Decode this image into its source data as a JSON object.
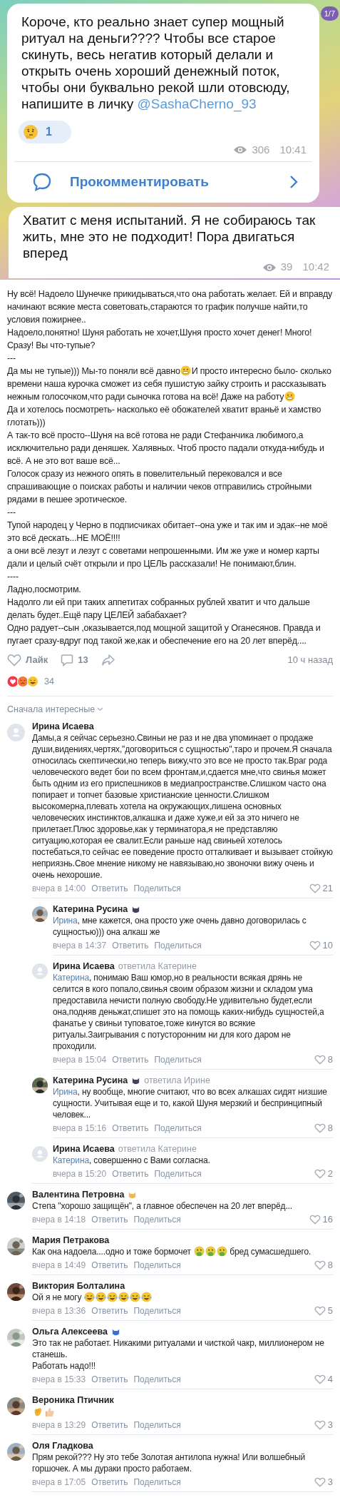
{
  "telegram": {
    "counter": "1/7",
    "messages": [
      {
        "body": [
          {
            "kind": "text",
            "text": "Короче, кто реально знает супер мощный ритуал на деньги???? Чтобы все старое скинуть, весь негатив который делали и открыть очень хороший денежный поток, чтобы они буквально рекой шли отовсюду, напишите в личку "
          },
          {
            "kind": "mention",
            "text": "@SashaCherno_93"
          }
        ],
        "reactions": [
          {
            "count": "1"
          }
        ],
        "views": "306",
        "time": "10:41",
        "comment_label": "Прокомментировать"
      },
      {
        "body": [
          {
            "kind": "text",
            "text": "Хватит с меня испытаний. Я не собираюсь так жить, мне это не подходит! Пора двигаться вперед"
          }
        ],
        "views": "39",
        "time": "10:42"
      }
    ]
  },
  "post": {
    "paragraphs": [
      [
        {
          "kind": "text",
          "text": "Ну всё! Надоело Шунечке прикидываться,что она работать желает. Ей и вправду начинают всякие места советовать,стараются то график получше найти,то условия пожирнее.."
        }
      ],
      [
        {
          "kind": "text",
          "text": "Надоело,понятно! Шуня работать не хочет,Шуня просто хочет денег! Много! Сразу! Вы что-тупые?"
        }
      ],
      [
        {
          "kind": "text",
          "text": "---"
        }
      ],
      [
        {
          "kind": "text",
          "text": "Да мы не тупые))) Мы-то поняли всё давно"
        },
        {
          "kind": "grin"
        },
        {
          "kind": "text",
          "text": "И просто интересно было- сколько времени наша курочка сможет из себя пушистую зайку строить и рассказывать нежным голосочком,что ради сыночка готова на всё! Даже на работу"
        },
        {
          "kind": "grin"
        }
      ],
      [
        {
          "kind": "text",
          "text": "Да и хотелось посмотреть- насколько её обожателей хватит враньё и хамство глотать)))"
        }
      ],
      [
        {
          "kind": "text",
          "text": "А так-то всё просто--Шуня на всё готова не ради Стефанчика любимого,а исключительно ради деняшек. Халявных. Чтоб просто падали откуда-нибудь и всё. А не это вот ваше всё..."
        }
      ],
      [
        {
          "kind": "text",
          "text": "Голосок сразу из нежного опять в повелительный перековался и все спрашивающие о поисках работы и наличии чеков отправились стройными рядами в пешее эротическое."
        }
      ],
      [
        {
          "kind": "text",
          "text": "---"
        }
      ],
      [
        {
          "kind": "text",
          "text": "Тупой народец у Черно в подписчиках обитает--она уже и так им и эдак--не моё это всё дескать...НЕ МОЁ!!!!"
        }
      ],
      [
        {
          "kind": "text",
          "text": "а они всё лезут и лезут с советами непрошенными. Им же уже и номер карты дали и целый счёт открыли и про ЦЕЛЬ рассказали! Не понимают,блин."
        }
      ],
      [
        {
          "kind": "text",
          "text": "----"
        }
      ],
      [
        {
          "kind": "text",
          "text": "Ладно,посмотрим."
        }
      ],
      [
        {
          "kind": "text",
          "text": "Надолго ли ей при таких аппетитах собранных рублей хватит и что дальше делать будет..Ещё пару ЦЕЛЕЙ забабахает?"
        }
      ],
      [
        {
          "kind": "text",
          "text": "Одно радует--сын ,оказывается,под мощной защитой у Оганесянов. Правда и пугает сразу-вдруг под такой же,как и обеспечение его на 20 лет вперёд...."
        }
      ]
    ],
    "like_label": "Лайк",
    "comments_count": "13",
    "time": "10 ч назад",
    "reactions_count": "34"
  },
  "comments_sort": "Сначала интересные",
  "comments": [
    {
      "author": "Ирина Исаева",
      "photo_avatar": false,
      "body": [
        [
          {
            "kind": "text",
            "text": "Дамы,а я сейчас серьезно.Свиньи не раз и не два упоминает о продаже души,видениях,чертях,\"договориться с сущностью\",таро и прочем.Я сначала относилась скептически,но теперь вижу,что это все не просто так.Враг рода человеческого ведет бои по всем фронтам,и,сдается мне,что свинья может быть одним из его приспешников в медиапространстве.Слишком часто она попирает и топчет базовые христианские ценности.Слишком высокомерна,плевать хотела на окружающих,лишена основных человеческих инстинктов,алкашка и даже хуже,и ей за это ничего не прилетает.Плюс здоровье,как у терминатора,я не представляю ситуацию,которая ее свалит.Если раньше над свиньей хотелось постебаться,то сейчас ее поведение просто отталкивает и вызывает стойкую неприязнь.Свое мнение никому не навязываю,но звоночки вижу очень и очень нехорошие."
          }
        ]
      ],
      "time": "вчера в 14:00",
      "reply_label": "Ответить",
      "share_label": "Поделиться",
      "likes": "21",
      "children": [
        {
          "author": "Катерина Русина",
          "badge": {
            "color": "#4a3f5c"
          },
          "photo_avatar": true,
          "body": [
            [
              {
                "kind": "mention",
                "text": "Ирина"
              },
              {
                "kind": "text",
                "text": ", мне кажется, она просто уже очень давно договорилась с сущностью))) она алкаш же"
              }
            ]
          ],
          "time": "вчера в 14:37",
          "reply_label": "Ответить",
          "share_label": "Поделиться",
          "likes": "10"
        },
        {
          "author": "Ирина Исаева",
          "replied_to": "ответила Катерине",
          "photo_avatar": false,
          "body": [
            [
              {
                "kind": "mention",
                "text": "Катерина"
              },
              {
                "kind": "text",
                "text": ", понимаю Ваш юмор,но в реальности всякая дрянь не селится в кого попало,свинья своим образом жизни и складом ума предоставила нечисти полную свободу.Не удивительно будет,если она,подняв деньжат,спишет это на помощь каких-нибудь сущностей,а фанатье у свиньи туповатое,тоже кинутся во всякие ритуалы.Заигрывания с потусторонним ни для кого даром не проходили."
              }
            ]
          ],
          "time": "вчера в 15:04",
          "reply_label": "Ответить",
          "share_label": "Поделиться",
          "likes": "8"
        },
        {
          "author": "Катерина Русина",
          "badge": {
            "color": "#4a3f5c"
          },
          "replied_to": "ответила Ирине",
          "photo_avatar": true,
          "body": [
            [
              {
                "kind": "mention",
                "text": "Ирина"
              },
              {
                "kind": "text",
                "text": ", ну вообще, многие считают, что во всех алкашах сидят низшие сущности. Учитывая еще и то, какой Шуня мерзкий и беспринципный человек..."
              }
            ]
          ],
          "time": "вчера в 15:16",
          "reply_label": "Ответить",
          "share_label": "Поделиться",
          "likes": "8"
        },
        {
          "author": "Ирина Исаева",
          "replied_to": "ответила Катерине",
          "photo_avatar": false,
          "body": [
            [
              {
                "kind": "mention",
                "text": "Катерина"
              },
              {
                "kind": "text",
                "text": ", совершенно с Вами согласна."
              }
            ]
          ],
          "time": "вчера в 15:20",
          "reply_label": "Ответить",
          "share_label": "Поделиться",
          "likes": "2"
        }
      ]
    },
    {
      "author": "Валентина Петровна",
      "badge": {
        "color": "#f2b84b"
      },
      "photo_avatar": true,
      "body": [
        [
          {
            "kind": "text",
            "text": "Степа \"хорошо защищён\", а главное обеспечен на 20 лет вперёд..."
          }
        ]
      ],
      "time": "вчера в 14:18",
      "reply_label": "Ответить",
      "share_label": "Поделиться",
      "likes": "16"
    },
    {
      "author": "Мария Петракова",
      "photo_avatar": true,
      "body": [
        [
          {
            "kind": "text",
            "text": "Как она надоела....одно и тоже бормочет "
          },
          {
            "kind": "sick"
          },
          {
            "kind": "sick"
          },
          {
            "kind": "sick"
          },
          {
            "kind": "text",
            "text": " бред сумасшедшего."
          }
        ]
      ],
      "time": "вчера в 14:49",
      "reply_label": "Ответить",
      "share_label": "Поделиться",
      "likes": "8"
    },
    {
      "author": "Виктория Болталина",
      "photo_avatar": true,
      "body": [
        [
          {
            "kind": "text",
            "text": "Ой я не могу "
          },
          {
            "kind": "laugh"
          },
          {
            "kind": "laugh"
          },
          {
            "kind": "laugh"
          },
          {
            "kind": "laugh"
          },
          {
            "kind": "laugh"
          },
          {
            "kind": "laugh"
          }
        ]
      ],
      "time": "вчера в 13:36",
      "reply_label": "Ответить",
      "share_label": "Поделиться",
      "likes": "5"
    },
    {
      "author": "Ольга Алексеева",
      "badge": {
        "color": "#3d6fd8"
      },
      "photo_avatar": true,
      "body": [
        [
          {
            "kind": "text",
            "text": "Это так не работает. Никакими ритуалами и чисткой чакр, миллионером не станешь."
          }
        ],
        [
          {
            "kind": "text",
            "text": "Работать надо!!!"
          }
        ]
      ],
      "time": "вчера в 15:33",
      "reply_label": "Ответить",
      "share_label": "Поделиться",
      "likes": "4"
    },
    {
      "author": "Вероника Птичник",
      "photo_avatar": true,
      "body": [
        [
          {
            "kind": "clap"
          },
          {
            "kind": "thumb"
          }
        ]
      ],
      "time": "вчера в 13:29",
      "reply_label": "Ответить",
      "share_label": "Поделиться",
      "likes": "3"
    },
    {
      "author": "Оля Гладкова",
      "photo_avatar": true,
      "body": [
        [
          {
            "kind": "text",
            "text": "Прям рекой??? Ну это тебе Золотая антилопа нужна! Или волшебный горшочек. А мы дураки просто работаем."
          }
        ]
      ],
      "time": "вчера в 17:05",
      "reply_label": "Ответить",
      "share_label": "Поделиться",
      "likes": "3"
    }
  ]
}
